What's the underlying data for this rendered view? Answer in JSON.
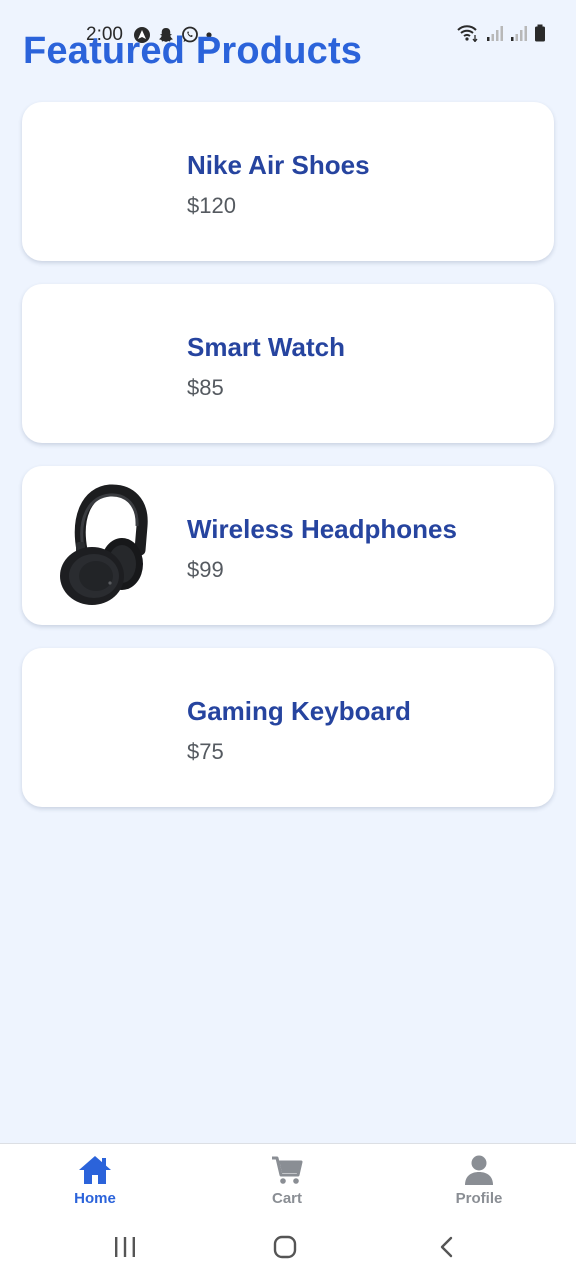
{
  "status_bar": {
    "time": "2:00",
    "notification_icons": [
      "navigation-app-icon",
      "snapchat-icon",
      "whatsapp-icon",
      "dot-icon"
    ],
    "system_icons": [
      "wifi-icon",
      "signal-icon",
      "signal-icon",
      "battery-icon"
    ]
  },
  "page": {
    "title": "Featured Products"
  },
  "products": [
    {
      "name": "Nike Air Shoes",
      "price": "$120",
      "has_image": false
    },
    {
      "name": "Smart Watch",
      "price": "$85",
      "has_image": false
    },
    {
      "name": "Wireless Headphones",
      "price": "$99",
      "has_image": true,
      "image_icon": "headphones-image"
    },
    {
      "name": "Gaming Keyboard",
      "price": "$75",
      "has_image": false
    }
  ],
  "bottom_nav": {
    "items": [
      {
        "label": "Home",
        "icon": "home-icon",
        "active": true
      },
      {
        "label": "Cart",
        "icon": "cart-icon",
        "active": false
      },
      {
        "label": "Profile",
        "icon": "person-icon",
        "active": false
      }
    ]
  },
  "system_nav": {
    "buttons": [
      "recent-apps-icon",
      "home-circle-icon",
      "back-icon"
    ]
  },
  "colors": {
    "background": "#eef4fe",
    "accent": "#2b63da",
    "product_name": "#26449f",
    "price": "#555a60",
    "inactive_nav": "#8a8e94"
  }
}
